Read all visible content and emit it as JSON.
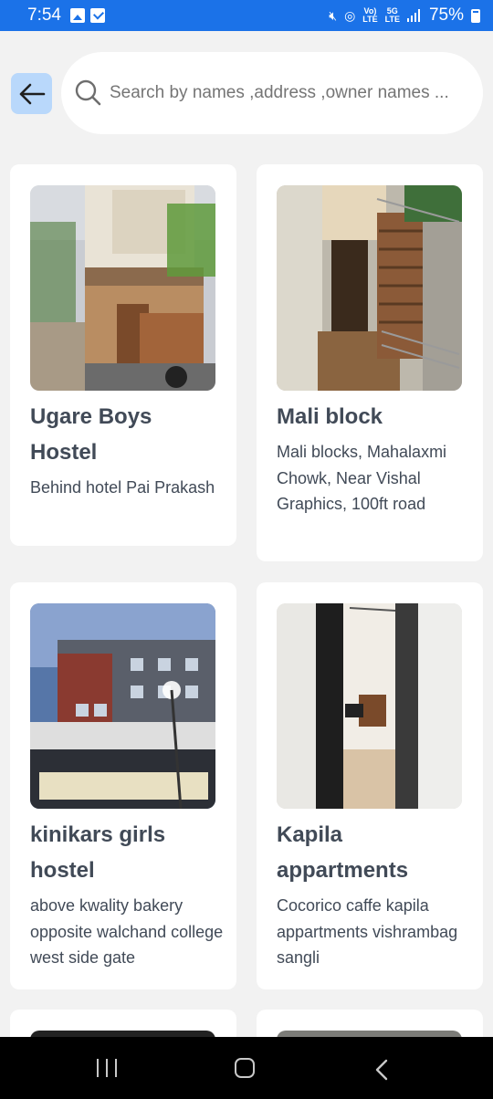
{
  "status_bar": {
    "time": "7:54",
    "network_top": "5G",
    "network_bottom": "LTE",
    "volte": "VoLTE",
    "battery": "75%"
  },
  "search": {
    "placeholder": "Search by names ,address ,owner names ..."
  },
  "icons": {
    "back": "arrow-left-icon",
    "search": "search-icon",
    "nav_recent": "recent-apps-icon",
    "nav_home": "home-icon",
    "nav_back": "chevron-left-icon"
  },
  "colors": {
    "status_bar": "#1b72e8",
    "back_button_bg": "#b9d8fb",
    "text": "#414a57",
    "page_bg": "#f2f2f2"
  },
  "hostels": [
    {
      "name": "Ugare Boys Hostel",
      "address": "Behind hotel Pai Prakash"
    },
    {
      "name": "Mali block",
      "address": "Mali blocks, Mahalaxmi Chowk, Near Vishal Graphics, 100ft road"
    },
    {
      "name": "kinikars  girls hostel",
      "address": "above kwality bakery opposite walchand college west side gate"
    },
    {
      "name": "Kapila appartments",
      "address": "Cocorico caffe kapila appartments vishrambag sangli"
    }
  ]
}
